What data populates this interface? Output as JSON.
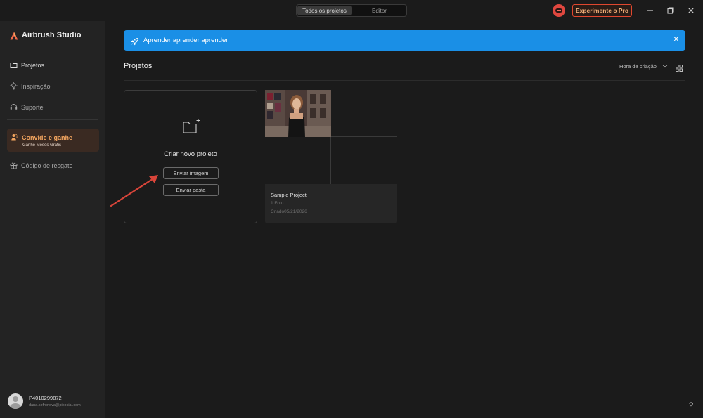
{
  "titlebar": {
    "tabs": [
      {
        "label": "Todos os projetos",
        "active": true
      },
      {
        "label": "Editor",
        "active": false
      }
    ],
    "pro_label": "Experimente o Pro"
  },
  "sidebar": {
    "brand": "Airbrush Studio",
    "items": [
      {
        "label": "Projetos",
        "icon": "folder-icon"
      },
      {
        "label": "Inspiração",
        "icon": "lightbulb-icon"
      },
      {
        "label": "Suporte",
        "icon": "headset-icon"
      }
    ],
    "invite": {
      "title": "Convide e ganhe",
      "subtitle": "Ganhe Meses Grátis"
    },
    "redeem_label": "Código de resgate",
    "user": {
      "name": "P4010299872",
      "email": "dana.sofronova@pixocial.com"
    }
  },
  "banner": {
    "text": "Aprender aprender aprender"
  },
  "main": {
    "title": "Projetos",
    "sort_label": "Hora de criação",
    "new_project": {
      "title": "Criar novo projeto",
      "upload_image": "Enviar imagem",
      "upload_folder": "Enviar pasta"
    },
    "projects": [
      {
        "name": "Sample Project",
        "count": "1 Foto",
        "created": "Criado05/21/2026"
      }
    ]
  },
  "colors": {
    "accent": "#1a8fe6",
    "pro": "#e0472f",
    "invite": "#f3a55f",
    "annotation_arrow": "#d9453a"
  },
  "help_label": "?"
}
